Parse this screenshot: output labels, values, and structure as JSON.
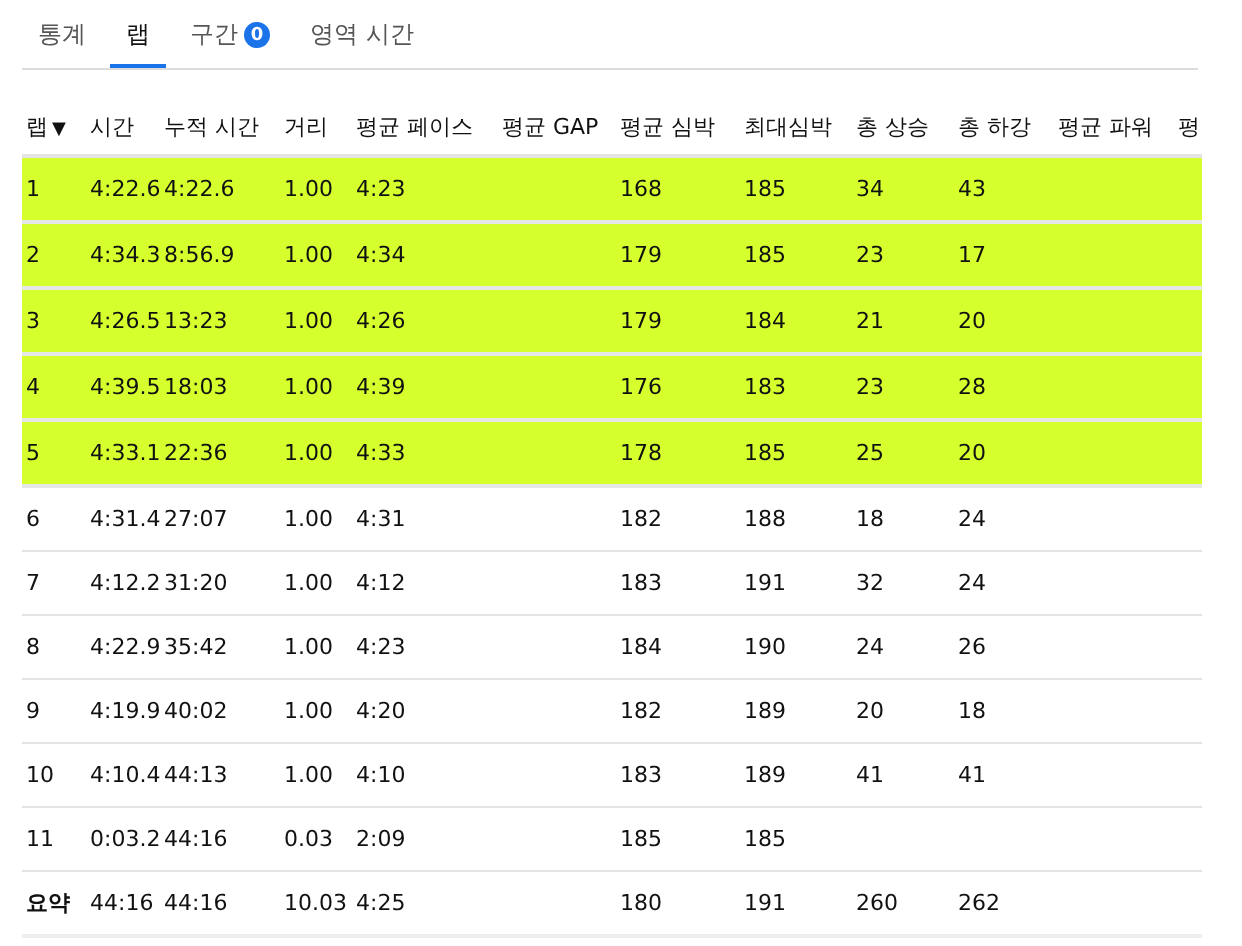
{
  "tabs": [
    {
      "label": "통계",
      "selected": false
    },
    {
      "label": "랩",
      "selected": true
    },
    {
      "label": "구간",
      "selected": false,
      "badge": "0"
    },
    {
      "label": "영역 시간",
      "selected": false
    }
  ],
  "table": {
    "columns": [
      {
        "label": "랩",
        "sort_icon": "▼"
      },
      {
        "label": "시간"
      },
      {
        "label": "누적 시간"
      },
      {
        "label": "거리"
      },
      {
        "label": "평균 페이스"
      },
      {
        "label": "평균 GAP"
      },
      {
        "label": "평균 심박"
      },
      {
        "label": "최대심박"
      },
      {
        "label": "총 상승"
      },
      {
        "label": "총 하강"
      },
      {
        "label": "평균 파워"
      },
      {
        "label": "평"
      }
    ],
    "rows": [
      {
        "selected": true,
        "cells": [
          "1",
          "4:22.6",
          "4:22.6",
          "1.00",
          "4:23",
          null,
          "168",
          "185",
          "34",
          "43",
          null,
          null
        ]
      },
      {
        "selected": true,
        "cells": [
          "2",
          "4:34.3",
          "8:56.9",
          "1.00",
          "4:34",
          null,
          "179",
          "185",
          "23",
          "17",
          null,
          null
        ]
      },
      {
        "selected": true,
        "cells": [
          "3",
          "4:26.5",
          "13:23",
          "1.00",
          "4:26",
          null,
          "179",
          "184",
          "21",
          "20",
          null,
          null
        ]
      },
      {
        "selected": true,
        "cells": [
          "4",
          "4:39.5",
          "18:03",
          "1.00",
          "4:39",
          null,
          "176",
          "183",
          "23",
          "28",
          null,
          null
        ]
      },
      {
        "selected": true,
        "cells": [
          "5",
          "4:33.1",
          "22:36",
          "1.00",
          "4:33",
          null,
          "178",
          "185",
          "25",
          "20",
          null,
          null
        ]
      },
      {
        "selected": false,
        "cells": [
          "6",
          "4:31.4",
          "27:07",
          "1.00",
          "4:31",
          null,
          "182",
          "188",
          "18",
          "24",
          null,
          null
        ]
      },
      {
        "selected": false,
        "cells": [
          "7",
          "4:12.2",
          "31:20",
          "1.00",
          "4:12",
          null,
          "183",
          "191",
          "32",
          "24",
          null,
          null
        ]
      },
      {
        "selected": false,
        "cells": [
          "8",
          "4:22.9",
          "35:42",
          "1.00",
          "4:23",
          null,
          "184",
          "190",
          "24",
          "26",
          null,
          null
        ]
      },
      {
        "selected": false,
        "cells": [
          "9",
          "4:19.9",
          "40:02",
          "1.00",
          "4:20",
          null,
          "182",
          "189",
          "20",
          "18",
          null,
          null
        ]
      },
      {
        "selected": false,
        "cells": [
          "10",
          "4:10.4",
          "44:13",
          "1.00",
          "4:10",
          null,
          "183",
          "189",
          "41",
          "41",
          null,
          null
        ]
      },
      {
        "selected": false,
        "cells": [
          "11",
          "0:03.2",
          "44:16",
          "0.03",
          "2:09",
          null,
          "185",
          "185",
          null,
          null,
          null,
          null
        ]
      },
      {
        "selected": false,
        "kind": "summary",
        "cells": [
          "요약",
          "44:16",
          "44:16",
          "10.03",
          "4:25",
          null,
          "180",
          "191",
          "260",
          "262",
          null,
          null
        ]
      }
    ]
  }
}
